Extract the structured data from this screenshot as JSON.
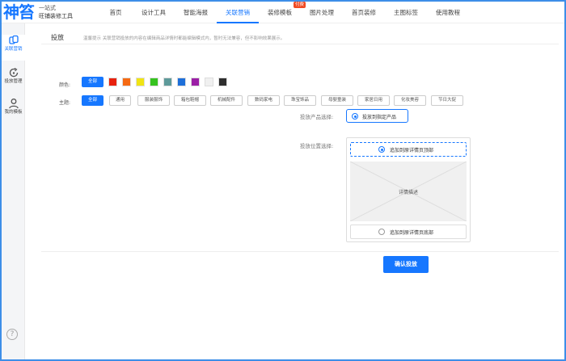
{
  "brand": {
    "logo_text": "神笞",
    "slogan_line1": "一站式",
    "slogan_line2": "旺铺装修工具"
  },
  "nav": [
    {
      "label": "首页",
      "active": false
    },
    {
      "label": "设计工具",
      "active": false
    },
    {
      "label": "智能海报",
      "active": false
    },
    {
      "label": "关联营销",
      "active": true
    },
    {
      "label": "装修模板",
      "active": false,
      "badge": "付费"
    },
    {
      "label": "图片处理",
      "active": false
    },
    {
      "label": "首页装修",
      "active": false
    },
    {
      "label": "主图标签",
      "active": false
    },
    {
      "label": "使用教程",
      "active": false
    }
  ],
  "sidebar": [
    {
      "label": "关联营销",
      "icon": "link-copy-icon",
      "active": true
    },
    {
      "label": "投放管理",
      "icon": "refresh-manage-icon",
      "active": false
    },
    {
      "label": "我的模板",
      "icon": "user-icon",
      "active": false
    }
  ],
  "section": {
    "title": "投放",
    "tip": "温馨提示 关联营销投放的内容在编辑商品详情时都能编辑模式内，暂时无法兼容，但不影响效果展示。"
  },
  "colors": {
    "label": "颜色:",
    "all_label": "全部",
    "swatches": [
      "#e8220e",
      "#f56a13",
      "#f0e414",
      "#36c21f",
      "#5e9a9a",
      "#1e6fd9",
      "#9b1fa6",
      "#f0f0f0",
      "#2e2e2e"
    ]
  },
  "topics": {
    "label": "主题:",
    "all_label": "全部",
    "items": [
      "通用",
      "服装服饰",
      "箱包鞋帽",
      "机械配件",
      "数码家电",
      "珠宝饰品",
      "母婴童装",
      "家居日用",
      "化妆美容",
      "节日大促"
    ]
  },
  "product_select": {
    "label": "投放产品选择:",
    "option": "投放到指定产品"
  },
  "position_select": {
    "label": "投放位置选择:",
    "top_option": "追加到原详情页顶部",
    "placeholder": "详情描述",
    "bottom_option": "追加到原详情页底部"
  },
  "confirm_label": "确认投放",
  "accent": "#1677ff",
  "help_icon": "?"
}
